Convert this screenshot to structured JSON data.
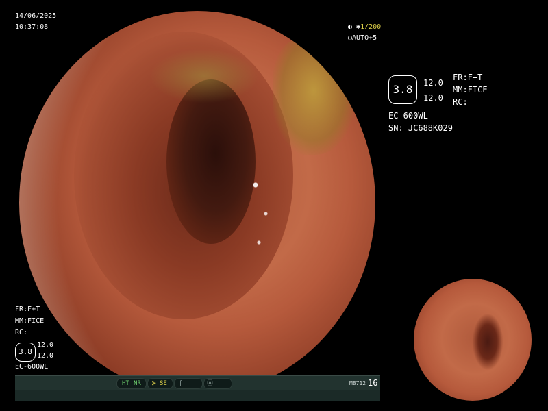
{
  "overlay": {
    "date": "14/06/2025",
    "time": "10:37:08",
    "shutter": "1/200",
    "shutter_symbol": "◐ ✱",
    "gain": "AUTO+5",
    "gain_symbol": "◯",
    "right_panel": {
      "zoom_value": "3.8",
      "val_1": "12.0",
      "val_2": "12.0",
      "fr": "FR:F+T",
      "mm": "MM:FICE",
      "rc": "RC:",
      "model": "EC-600WL",
      "serial": "SN: JC688K029"
    },
    "left_panel": {
      "fr": "FR:F+T",
      "mm": "MM:FICE",
      "rc": "RC:",
      "zoom_value": "3.8",
      "val_1": "12.0",
      "val_2": "12.0",
      "model": "EC-600WL"
    }
  },
  "status_bar": {
    "chip_ht": "HT",
    "chip_nr": "NR",
    "chip_se_prefix": "⊱",
    "chip_se": "SE",
    "chip_f": "ƒ",
    "chip_a": "Ⓐ",
    "code": "M8712",
    "count": "16"
  },
  "colors": {
    "overlay_text": "#ffffff",
    "shutter_accent": "#e0d24a",
    "status_bar_bg": "#1b2a27",
    "chip_green": "#6fd26f",
    "chip_yellow": "#e0d24a"
  }
}
